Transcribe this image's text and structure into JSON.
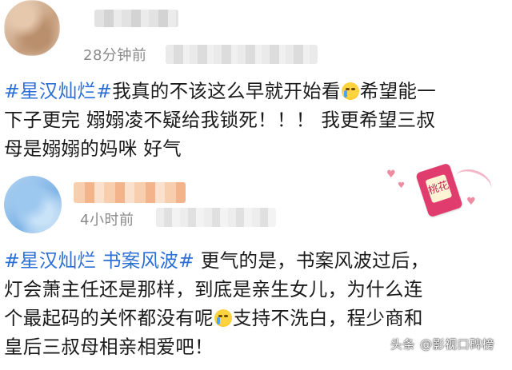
{
  "posts": [
    {
      "time": "28分钟前",
      "body_lines": [
        [
          {
            "t": "tag",
            "v": "#星汉灿烂#"
          },
          {
            "t": "text",
            "v": "我真的不该这么早就开始看"
          },
          {
            "t": "emoji",
            "v": "crying-face"
          },
          {
            "t": "text",
            "v": "希望能一"
          }
        ],
        [
          {
            "t": "text",
            "v": "下子更完 嫋嫋凌不疑给我锁死！！！ 我更希望三叔"
          }
        ],
        [
          {
            "t": "text",
            "v": "母是嫋嫋的妈咪 好气"
          }
        ]
      ]
    },
    {
      "time": "4小时前",
      "body_lines": [
        [
          {
            "t": "tag",
            "v": "#星汉灿烂 书案风波#"
          },
          {
            "t": "text",
            "v": " 更气的是，书案风波过后，"
          }
        ],
        [
          {
            "t": "text",
            "v": "灯会萧主任还是那样，到底是亲生女儿，为什么连"
          }
        ],
        [
          {
            "t": "text",
            "v": "个最起码的关怀都没有呢"
          },
          {
            "t": "emoji",
            "v": "crying-face"
          },
          {
            "t": "text",
            "v": "支持不洗白，程少商和"
          }
        ],
        [
          {
            "t": "text",
            "v": "皇后三叔母相亲相爱吧！"
          }
        ]
      ],
      "sticker_text": "桃花"
    }
  ],
  "watermark": {
    "logo": "头条",
    "text": "@影视口碑榜"
  },
  "colors": {
    "hashtag": "#2c6fd6",
    "time": "#8a8a8a",
    "text": "#1a1a1a"
  }
}
